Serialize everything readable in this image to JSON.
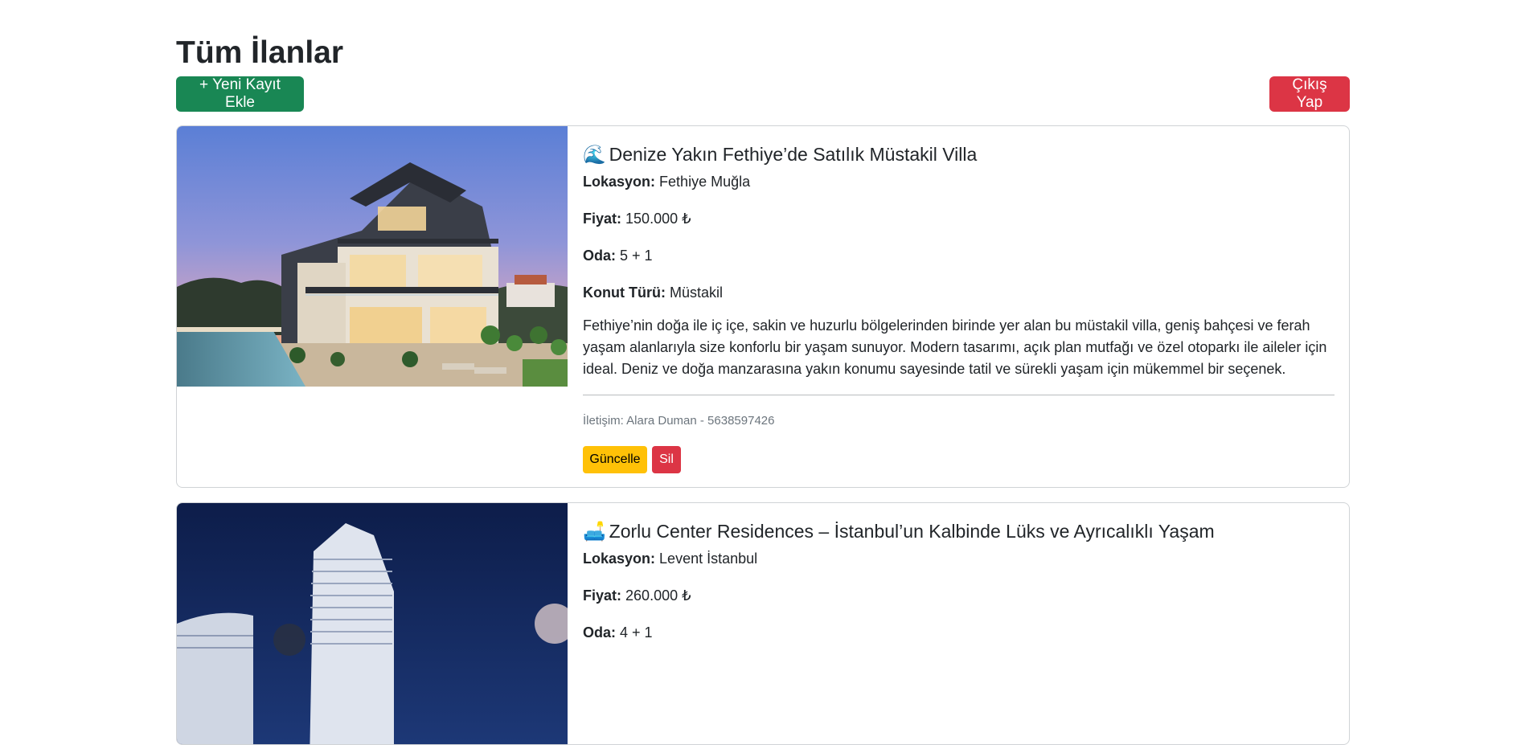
{
  "page": {
    "title": "Tüm İlanlar",
    "add_button": "+ Yeni Kayıt Ekle",
    "logout_button": "Çıkış Yap"
  },
  "labels": {
    "location": "Lokasyon:",
    "price": "Fiyat:",
    "rooms": "Oda:",
    "type": "Konut Türü:"
  },
  "listings": [
    {
      "emoji": "🌊",
      "title": "Denize Yakın Fethiye’de Satılık Müstakil Villa",
      "location": "Fethiye Muğla",
      "price": "150.000 ₺",
      "rooms": "5 + 1",
      "type": "Müstakil",
      "description": "Fethiye’nin doğa ile iç içe, sakin ve huzurlu bölgelerinden birinde yer alan bu müstakil villa, geniş bahçesi ve ferah yaşam alanlarıyla size konforlu bir yaşam sunuyor. Modern tasarımı, açık plan mutfağı ve özel otoparkı ile aileler için ideal. Deniz ve doğa manzarasına yakın konumu sayesinde tatil ve sürekli yaşam için mükemmel bir seçenek.",
      "contact": "İletişim: Alara Duman - 5638597426",
      "update_button": "Güncelle",
      "delete_button": "Sil"
    },
    {
      "emoji": "🛋️",
      "title": "Zorlu Center Residences – İstanbul’un Kalbinde Lüks ve Ayrıcalıklı Yaşam",
      "location": "Levent İstanbul",
      "price": "260.000 ₺",
      "rooms": "4 + 1"
    }
  ],
  "colors": {
    "success": "#198754",
    "danger": "#dc3545",
    "warning": "#ffc107"
  }
}
